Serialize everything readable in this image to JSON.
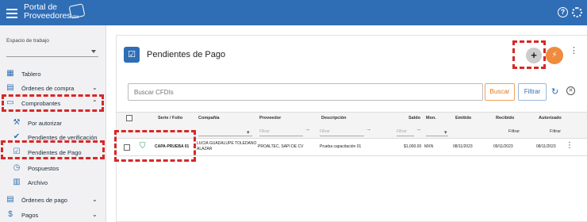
{
  "topbar": {
    "logo_line1": "Portal de",
    "logo_line2": "Proveedores",
    "logo_suffix": ".mx",
    "icons": [
      "menu-icon",
      "help-icon",
      "settings-icon"
    ],
    "color": "#2f6db5"
  },
  "sidebar": {
    "workspace_label": "Espacio de trabajo",
    "workspace_value": "",
    "items": [
      {
        "label": "Tablero",
        "icon": "dashboard-icon"
      },
      {
        "label": "Órdenes de compra",
        "icon": "purchase-orders-icon",
        "expanded": false
      },
      {
        "label": "Comprobantes",
        "icon": "receipts-icon",
        "expanded": true
      },
      {
        "label": "Por autorizar",
        "icon": "gavel-icon"
      },
      {
        "label": "Pendientes de verificación",
        "icon": "verify-icon"
      },
      {
        "label": "Pendientes de Pago",
        "icon": "pending-payment-icon",
        "selected": true
      },
      {
        "label": "Pospuestos",
        "icon": "clock-icon"
      },
      {
        "label": "Archivo",
        "icon": "archive-icon"
      },
      {
        "label": "Órdenes de pago",
        "icon": "payment-orders-icon",
        "expanded": false
      },
      {
        "label": "Pagos",
        "icon": "payments-icon",
        "expanded": false
      }
    ]
  },
  "main": {
    "title": "Pendientes de Pago",
    "search_placeholder": "Buscar CFDIs",
    "buscar_label": "Buscar",
    "filtrar_label": "Filtrar",
    "accent_orange": "#f08a3e"
  },
  "table": {
    "columns": [
      "Serie / Folio",
      "Compañía",
      "Proveedor",
      "Descripción",
      "Saldo",
      "Mon.",
      "Emitido",
      "Recibido",
      "Autorizado"
    ],
    "filter_placeholder": "Filtrar",
    "filter_label": "Filtrar",
    "rows": [
      {
        "serie_folio": "CAPA-PRUEBA 01",
        "compania": "LUCIA GUADALUPE TOLEDANO\nALAZAR",
        "proveedor": "PROALTEC, SAPI DE CV",
        "descripcion": "Prueba capacitación 01",
        "saldo": "$1,000.00",
        "moneda": "MXN",
        "emitido": "08/11/2023",
        "recibido": "09/11/2023",
        "autorizado": "08/11/2023"
      }
    ]
  }
}
